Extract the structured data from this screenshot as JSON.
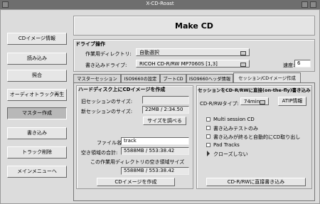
{
  "window": {
    "title": "X-CD-Roast"
  },
  "sidebar": {
    "items": [
      {
        "label": "CDイメージ情報"
      },
      {
        "label": "読み込み"
      },
      {
        "label": "照合"
      },
      {
        "label": "オーディオトラック再生"
      },
      {
        "label": "マスター作成"
      },
      {
        "label": "書き込み"
      },
      {
        "label": "トラック削除"
      },
      {
        "label": "メインメニューへ"
      }
    ]
  },
  "header": {
    "title": "Make CD"
  },
  "drive": {
    "group_label": "ドライブ操作",
    "workdir_label": "作業用ディレクトリ:",
    "workdir_value": "自動選択",
    "writer_label": "書き込みドライブ:",
    "writer_value": "RICOH   CD-R/RW MP7060S  [1,3]",
    "speed_label": "速度:",
    "speed_value": "6"
  },
  "tabs": [
    {
      "label": "マスターセッション"
    },
    {
      "label": "ISO9660の設定"
    },
    {
      "label": "ブートCD"
    },
    {
      "label": "ISO9660ヘッダ情報"
    },
    {
      "label": "セッション/CDイメージ作成"
    }
  ],
  "left_panel": {
    "title": "ハードディスク上にCDイメージを作成",
    "old_session_label": "旧セッションのサイズ:",
    "old_session_value": "",
    "new_session_label": "新セッションのサイズ:",
    "new_session_value": "22MB / 2:34.50",
    "calc_button": "サイズを調べる",
    "filename_label": "ファイル名",
    "filename_value": "track",
    "free_total_label": "空き領域の合計:",
    "free_total_value": "5588MB / 553:38.42",
    "free_dir_label": "この作業用ディレクトリの空き領域サイズ",
    "free_dir_value": "5588MB / 553:38.42",
    "create_button": "CDイメージを作成"
  },
  "right_panel": {
    "title": "セッションをCD-R/RWに直接(on-the-fly)書き込み",
    "type_label": "CD-R/RWタイプ:",
    "type_value": "74min",
    "atip_button": "ATIP情報",
    "options": [
      {
        "label": "Multi session CD",
        "checked": false
      },
      {
        "label": "書き込みテストのみ",
        "checked": false
      },
      {
        "label": "書き込みが終ると自動的にCD取り出し",
        "checked": false
      },
      {
        "label": "Pad Tracks",
        "checked": false
      },
      {
        "label": "クローズしない",
        "checked": false
      }
    ],
    "write_button": "CD-R/RWに直接書き込み"
  }
}
